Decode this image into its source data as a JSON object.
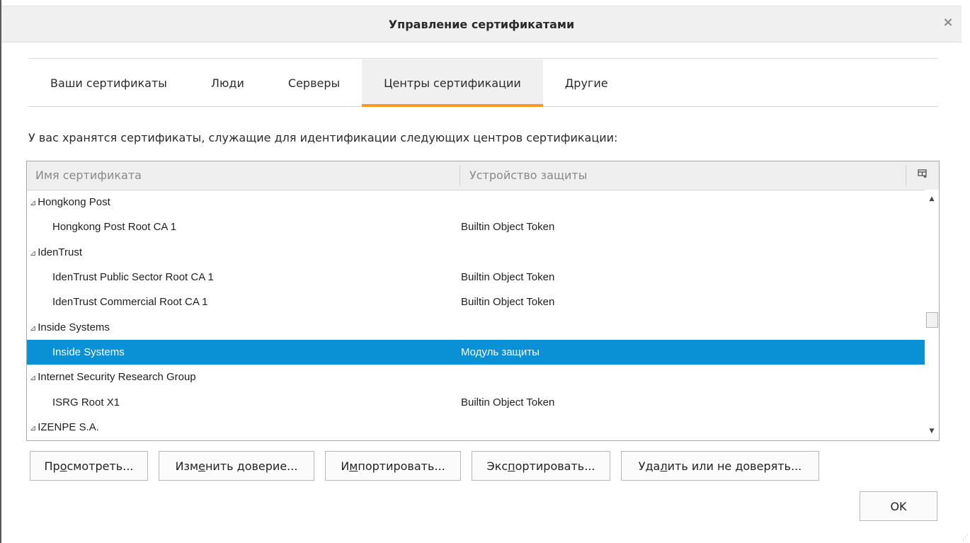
{
  "window": {
    "title": "Управление сертификатами",
    "close_icon": "close-icon"
  },
  "tabs": [
    {
      "label": "Ваши сертификаты",
      "selected": false
    },
    {
      "label": "Люди",
      "selected": false
    },
    {
      "label": "Серверы",
      "selected": false
    },
    {
      "label": "Центры сертификации",
      "selected": true
    },
    {
      "label": "Другие",
      "selected": false
    }
  ],
  "accent_color": "#f89a1c",
  "selection_color": "#0a90d5",
  "description": "У вас хранятся сертификаты, служащие для идентификации следующих центров сертификации:",
  "tree": {
    "columns": {
      "name": "Имя сертификата",
      "device": "Устройство защиты",
      "picker_icon": "column-picker-icon"
    },
    "twisty_glyph": "⊿",
    "rows": [
      {
        "type": "group",
        "name": "Hongkong Post",
        "device": ""
      },
      {
        "type": "child",
        "name": "Hongkong Post Root CA 1",
        "device": "Builtin Object Token"
      },
      {
        "type": "group",
        "name": "IdenTrust",
        "device": ""
      },
      {
        "type": "child",
        "name": "IdenTrust Public Sector Root CA 1",
        "device": "Builtin Object Token"
      },
      {
        "type": "child",
        "name": "IdenTrust Commercial Root CA 1",
        "device": "Builtin Object Token"
      },
      {
        "type": "group",
        "name": "Inside Systems",
        "device": ""
      },
      {
        "type": "child",
        "name": "Inside Systems",
        "device": "Модуль защиты",
        "selected": true
      },
      {
        "type": "group",
        "name": "Internet Security Research Group",
        "device": ""
      },
      {
        "type": "child",
        "name": "ISRG Root X1",
        "device": "Builtin Object Token"
      },
      {
        "type": "group",
        "name": "IZENPE S.A.",
        "device": ""
      }
    ]
  },
  "buttons": {
    "view": {
      "pre": "Пр",
      "u": "о",
      "post": "смотреть..."
    },
    "edit_trust": {
      "pre": "Изм",
      "u": "е",
      "post": "нить доверие..."
    },
    "import": {
      "pre": "И",
      "u": "м",
      "post": "портировать..."
    },
    "export": {
      "pre": "Экс",
      "u": "п",
      "post": "ортировать..."
    },
    "delete": {
      "pre": "Уда",
      "u": "л",
      "post": "ить или не доверять..."
    },
    "ok": "OK"
  }
}
